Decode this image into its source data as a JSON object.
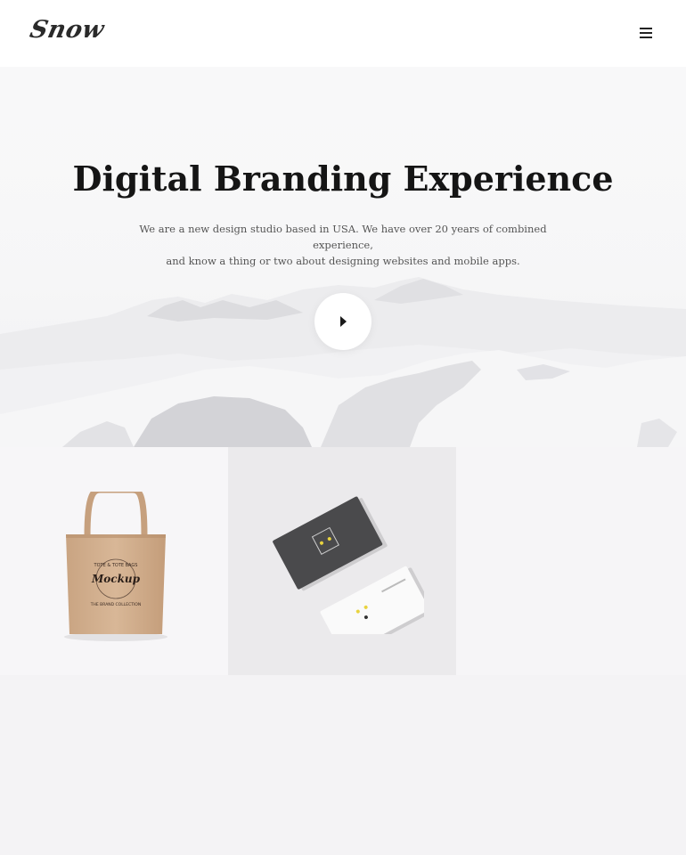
{
  "header": {
    "logo_text": "Snow",
    "menu_icon": "hamburger-menu-icon"
  },
  "hero": {
    "title": "Digital Branding Experience",
    "subtitle_line1": "We are a new design studio based in USA. We have over 20 years of combined experience,",
    "subtitle_line2": "and know a thing or two about designing websites and mobile apps.",
    "play_icon": "play-icon",
    "background": "snowy-mountains"
  },
  "portfolio": {
    "items": [
      {
        "image": "tote-bag-mockup",
        "bag_text_top": "TOTE & TOTE BAGS",
        "bag_text_main": "Mockup",
        "bag_text_bottom": "THE BRAND COLLECTION"
      },
      {
        "image": "business-cards-mockup"
      },
      {
        "image": "empty"
      }
    ]
  },
  "colors": {
    "page_background": "#f4f3f5",
    "header_background": "#ffffff",
    "title_color": "#151515",
    "text_color": "#555555"
  }
}
